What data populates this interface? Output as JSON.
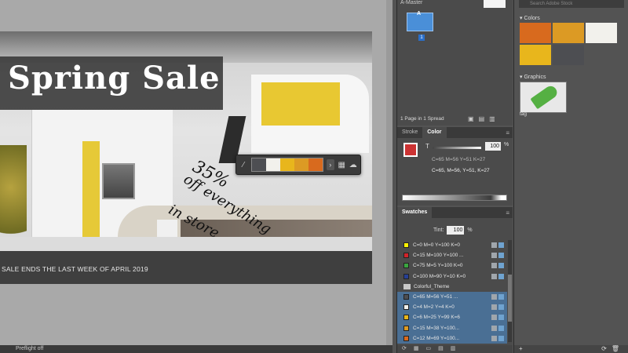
{
  "document": {
    "title": "Spring Sale",
    "footer": "SALE ENDS THE LAST WEEK OF APRIL 2019",
    "handwriting": {
      "line1": "35%",
      "line2": "off everything",
      "line3": "in store"
    }
  },
  "theme_popup": {
    "swatches": [
      "#4d4e52",
      "#f2f1ec",
      "#e8b61c",
      "#dc9a24",
      "#d86a1e"
    ],
    "more": "›"
  },
  "statusbar": {
    "preflight": "Preflight off"
  },
  "pages_panel": {
    "master": "A-Master",
    "page_letter": "A",
    "page_number": "1",
    "info": "1 Page in 1 Spread"
  },
  "color_panel": {
    "tabs": [
      "Stroke",
      "Color"
    ],
    "tint_label": "T",
    "tint_value": "100",
    "tint_unit": "%",
    "cmyk_ghost": "C=65 M=56 Y=51 K=27",
    "cmyk_value": "C=65, M=56, Y=51, K=27"
  },
  "swatches_panel": {
    "tab": "Swatches",
    "tint_label": "Tint:",
    "tint_value": "100",
    "tint_unit": "%",
    "rows": [
      {
        "name": "C=0 M=0 Y=100 K=0",
        "color": "#fff200",
        "selected": false
      },
      {
        "name": "C=15 M=100 Y=100 ...",
        "color": "#d2232a",
        "selected": false
      },
      {
        "name": "C=75 M=5 Y=100 K=0",
        "color": "#3aa53f",
        "selected": false
      },
      {
        "name": "C=100 M=90 Y=10 K=0",
        "color": "#263f95",
        "selected": false
      },
      {
        "name": "Colorful_Theme",
        "color": "",
        "selected": false,
        "folder": true
      },
      {
        "name": "C=65 M=56 Y=51 ...",
        "color": "#4d4e52",
        "selected": true
      },
      {
        "name": "C=4 M=2 Y=4 K=0",
        "color": "#f2f1ec",
        "selected": true
      },
      {
        "name": "C=6 M=25 Y=99 K=6",
        "color": "#e8b61c",
        "selected": true
      },
      {
        "name": "C=15 M=38 Y=100...",
        "color": "#dc9a24",
        "selected": true
      },
      {
        "name": "C=12 M=69 Y=100...",
        "color": "#d86a1e",
        "selected": true
      }
    ]
  },
  "cc_libraries": {
    "search_placeholder": "Search Adobe Stock",
    "colors_label": "Colors",
    "graphics_label": "Graphics",
    "colors": [
      "#d86a1e",
      "#dc9a24",
      "#f2f1ec",
      "#e8b61c",
      "#4d4e52"
    ],
    "graphic_name": "tag",
    "add": "+"
  }
}
